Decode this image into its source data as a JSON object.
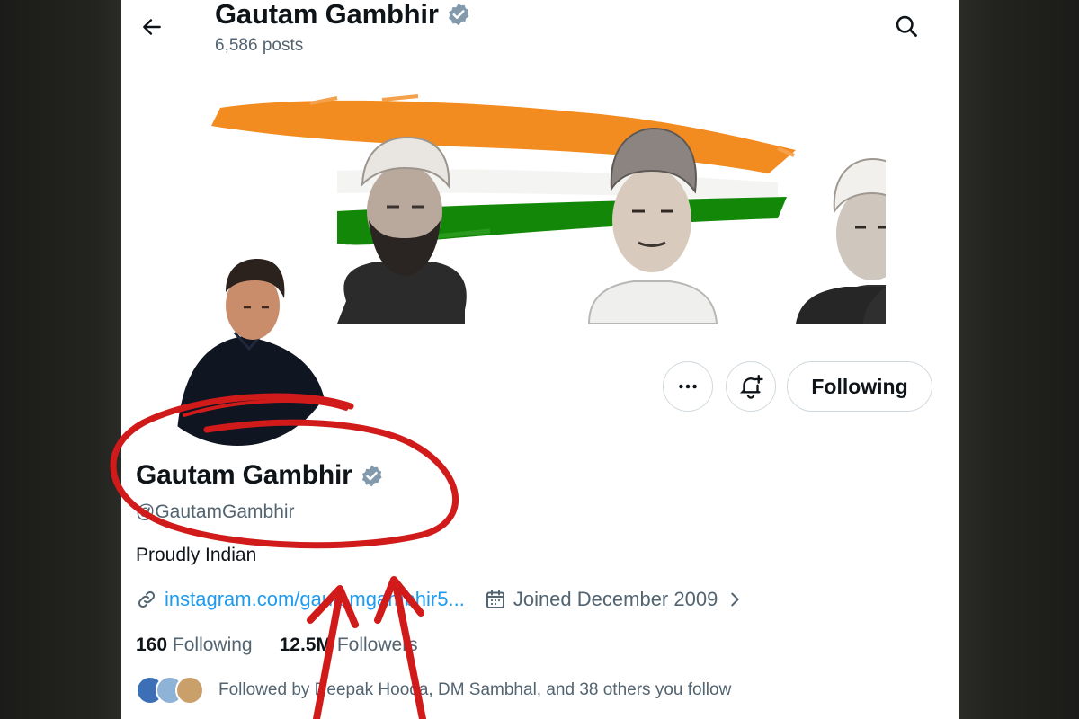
{
  "header": {
    "title": "Gautam Gambhir",
    "posts": "6,586 posts"
  },
  "profile": {
    "name": "Gautam Gambhir",
    "handle": "@GautamGambhir",
    "bio": "Proudly Indian",
    "link": "instagram.com/gautamgambhir5...",
    "joined": "Joined December 2009",
    "following_count": "160",
    "following_label": "Following",
    "followers_count": "12.5M",
    "followers_label": "Followers",
    "followed_by": "Followed by Deepak Hooda, DM Sambhal, and 38 others you follow"
  },
  "buttons": {
    "follow_state": "Following"
  },
  "icons": {
    "back": "arrow-left-icon",
    "search": "search-icon",
    "verified": "verified-badge-icon",
    "more": "more-dots-icon",
    "notify": "bell-plus-icon",
    "link": "link-icon",
    "calendar": "calendar-icon",
    "chevron": "chevron-right-icon"
  },
  "colors": {
    "accent": "#1d9bf0",
    "verified": "#829aab",
    "text_secondary": "#536471",
    "annotation": "#d11a1a",
    "flag_saffron": "#f28b20",
    "flag_green": "#138808"
  }
}
